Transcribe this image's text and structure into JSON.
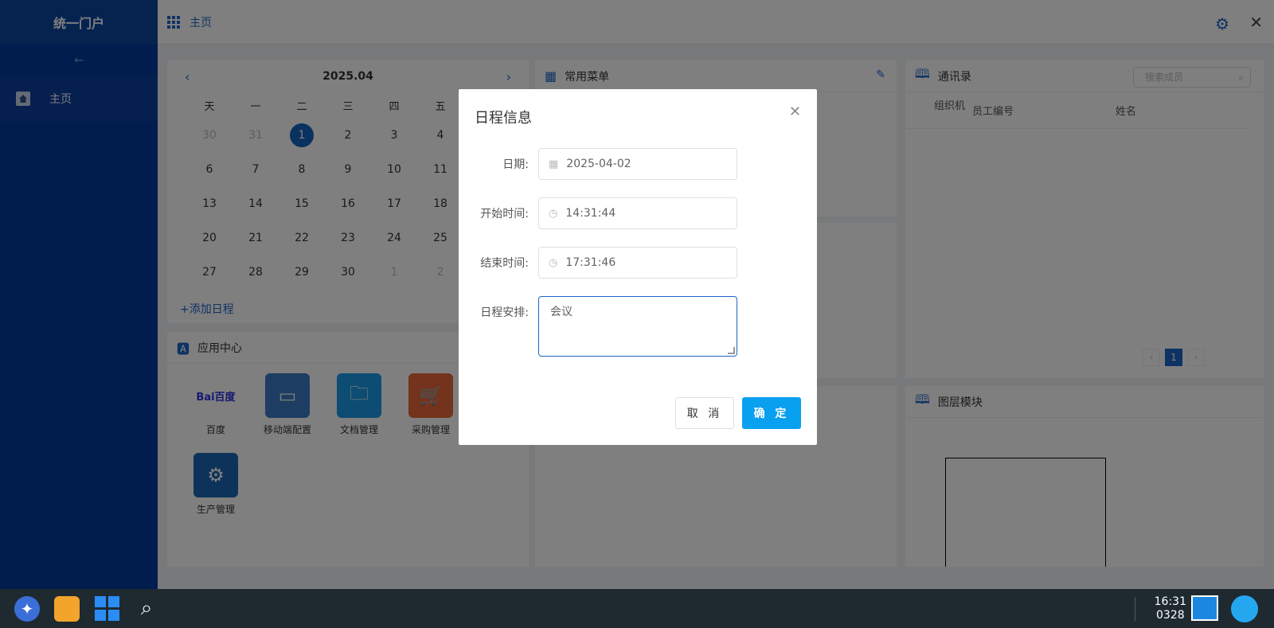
{
  "sidebar": {
    "brand": "统一门户",
    "collapse_icon": "←",
    "nav": [
      {
        "label": "主页"
      }
    ]
  },
  "header": {
    "title": "主页"
  },
  "calendar": {
    "month": "2025.04",
    "weekdays": [
      "天",
      "一",
      "二",
      "三",
      "四",
      "五"
    ],
    "rows": [
      [
        "30",
        "31",
        "1",
        "2",
        "3",
        "4"
      ],
      [
        "6",
        "7",
        "8",
        "9",
        "10",
        "11"
      ],
      [
        "13",
        "14",
        "15",
        "16",
        "17",
        "18"
      ],
      [
        "20",
        "21",
        "22",
        "23",
        "24",
        "25"
      ],
      [
        "27",
        "28",
        "29",
        "30",
        "1",
        "2"
      ]
    ],
    "add_label": "+添加日程"
  },
  "common_menu": {
    "title": "常用菜单"
  },
  "apps": {
    "title": "应用中心",
    "items": [
      {
        "label": "百度"
      },
      {
        "label": "移动端配置"
      },
      {
        "label": "文档管理"
      },
      {
        "label": "采购管理"
      },
      {
        "label": "生产管理"
      }
    ]
  },
  "contacts": {
    "title": "通讯录",
    "search_placeholder": "搜索成员",
    "col_org": "组织机",
    "col_id": "员工编号",
    "col_name": "姓名",
    "page": "1"
  },
  "layers": {
    "title": "图层模块"
  },
  "dialog": {
    "title": "日程信息",
    "date_label": "日期:",
    "date_value": "2025-04-02",
    "start_label": "开始时间:",
    "start_value": "14:31:44",
    "end_label": "结束时间:",
    "end_value": "17:31:46",
    "arrangement_label": "日程安排:",
    "arrangement_value": "会议",
    "cancel": "取 消",
    "ok": "确 定"
  },
  "taskbar": {
    "time": "16:31",
    "date": "0328"
  }
}
